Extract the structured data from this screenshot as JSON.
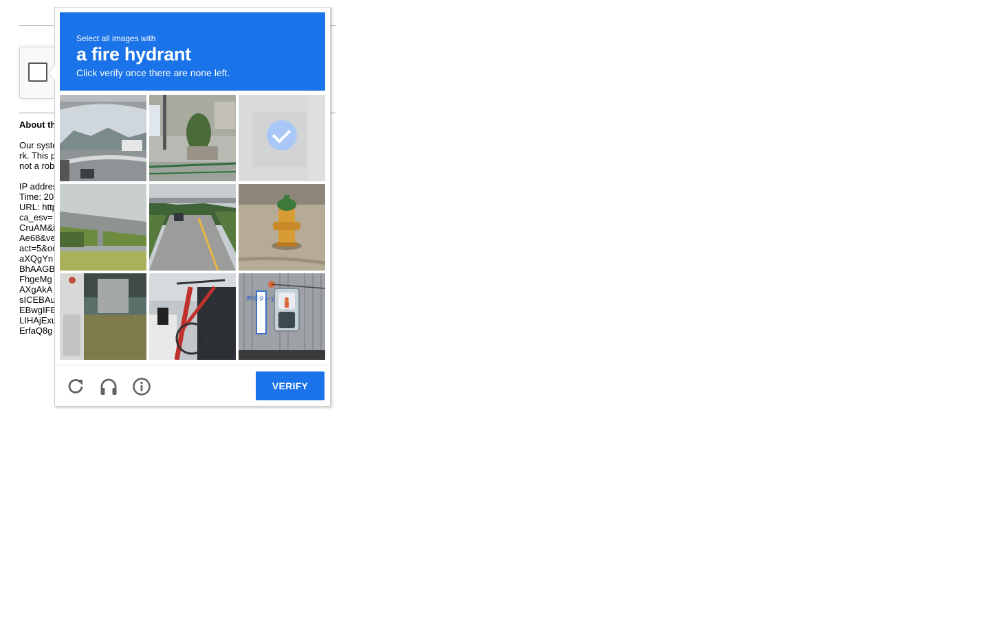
{
  "background_page": {
    "about_title": "About th",
    "about_lines": [
      "Our syste",
      "rk. This p",
      "not a rob"
    ],
    "info_lines": [
      "IP addres",
      "Time: 202",
      "URL: http",
      "ca_esv=",
      "CruAM&i",
      "Ae68&ve",
      "act=5&oc",
      "aXQgYn",
      "BhAAGB",
      "FhgeMg",
      "AXgAkA",
      "sICEBAu",
      "EBwgIFE",
      "LIHAjExu",
      "ErfaQ8g"
    ]
  },
  "challenge": {
    "instruction_prefix": "Select all images with",
    "target_object": "a fire hydrant",
    "instruction_hint": "Click verify once there are none left.",
    "tiles": [
      {
        "content": "highway overpass with mountains"
      },
      {
        "content": "street with truck and bushes"
      },
      {
        "content": "selected (faded)",
        "selected": true
      },
      {
        "content": "highway bridge"
      },
      {
        "content": "road with car"
      },
      {
        "content": "fire hydrant"
      },
      {
        "content": "truck and railing"
      },
      {
        "content": "bicycles near car"
      },
      {
        "content": "pedestrian traffic signal"
      }
    ],
    "sign_text": "押ボタン式",
    "icons": [
      "reload-icon",
      "headphones-icon",
      "info-icon"
    ],
    "verify_label": "VERIFY",
    "colors": {
      "accent": "#1a73e8",
      "selected_check": "#a9c7f6"
    }
  }
}
